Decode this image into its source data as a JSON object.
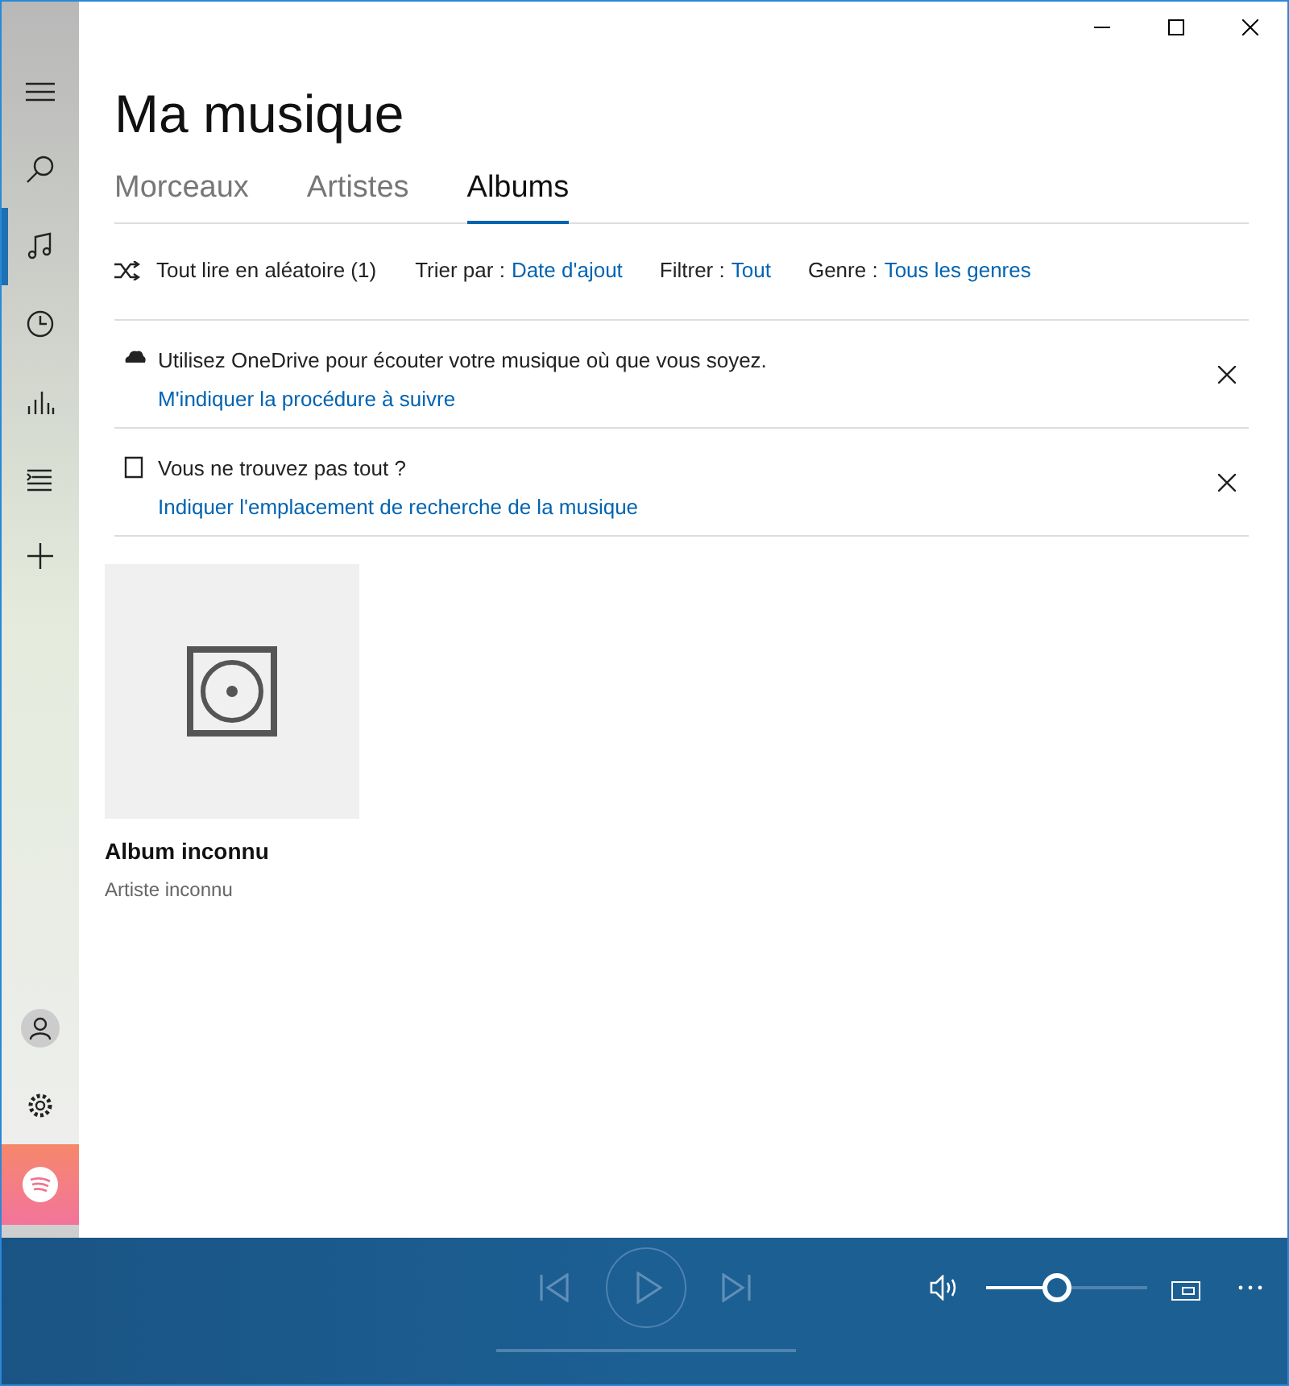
{
  "window": {
    "title": "Ma musique"
  },
  "nav": [
    {
      "kind": "menu",
      "selected": false
    },
    {
      "kind": "search",
      "selected": false
    },
    {
      "kind": "music",
      "selected": true
    },
    {
      "kind": "recent",
      "selected": false
    },
    {
      "kind": "bars",
      "selected": false
    },
    {
      "kind": "list",
      "selected": false
    },
    {
      "kind": "add",
      "selected": false
    }
  ],
  "tabs": [
    {
      "label": "Morceaux",
      "selected": false
    },
    {
      "label": "Artistes",
      "selected": false
    },
    {
      "label": "Albums",
      "selected": true
    }
  ],
  "toolbar": {
    "shuffle": "Tout lire en aléatoire (1)",
    "filters": [
      {
        "label": "Trier par :",
        "value": "Date d'ajout"
      },
      {
        "label": "Filtrer :",
        "value": "Tout"
      },
      {
        "label": "Genre :",
        "value": "Tous les genres"
      }
    ]
  },
  "notices": [
    {
      "kind": "cloud",
      "text": "Utilisez OneDrive pour écouter votre musique où que vous soyez.",
      "link": "M'indiquer la procédure à suivre"
    },
    {
      "kind": "device",
      "text": "Vous ne trouvez pas tout ?",
      "link": "Indiquer l'emplacement de recherche de la musique"
    }
  ],
  "albums": [
    {
      "title": "Album inconnu",
      "artist": "Artiste inconnu"
    }
  ],
  "player": {
    "progress": {
      "level": 0
    },
    "volume": {
      "level": 0.44
    }
  }
}
